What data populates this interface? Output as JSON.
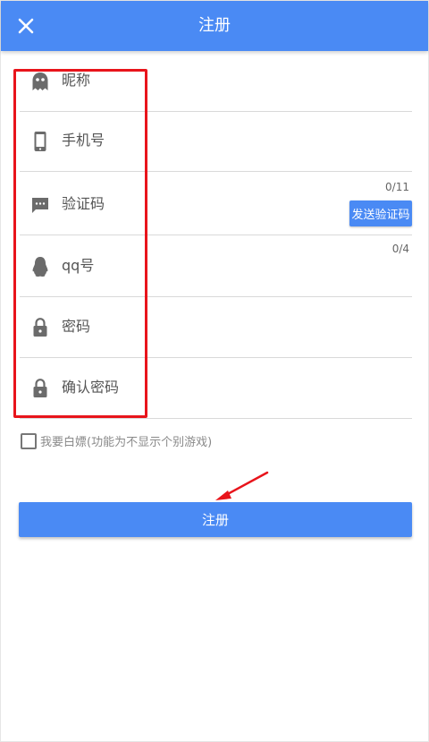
{
  "header": {
    "title": "注册",
    "close_icon": "close-icon"
  },
  "form": {
    "fields": [
      {
        "label": "昵称",
        "icon": "ghost-icon"
      },
      {
        "label": "手机号",
        "icon": "phone-icon"
      },
      {
        "label": "验证码",
        "icon": "message-icon"
      },
      {
        "label": "qq号",
        "icon": "penguin-icon"
      },
      {
        "label": "密码",
        "icon": "lock-icon"
      },
      {
        "label": "确认密码",
        "icon": "lock-icon"
      }
    ],
    "phone_counter": "0/11",
    "code_counter": "0/4",
    "send_code_label": "发送验证码",
    "agree_label": "我要白嫖(功能为不显示个别游戏)",
    "agree_checked": false
  },
  "submit": {
    "label": "注册"
  },
  "colors": {
    "accent": "#4a8af4",
    "highlight": "#e8141b"
  }
}
